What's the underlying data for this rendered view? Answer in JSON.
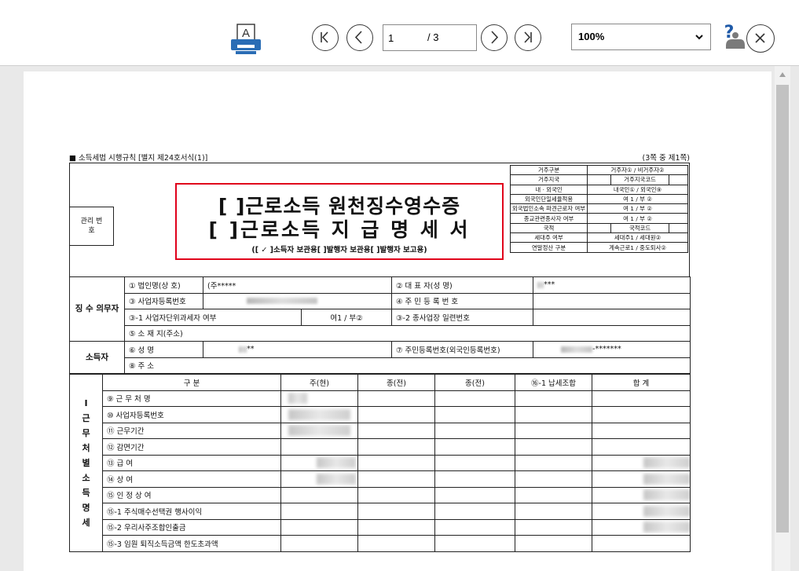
{
  "toolbar": {
    "page_current": "1",
    "page_total": "/ 3",
    "zoom": "100%",
    "icons": {
      "print": "print-icon",
      "first": "first-page-icon",
      "prev": "prev-page-icon",
      "next": "next-page-icon",
      "last": "last-page-icon",
      "help": "help-icon",
      "close": "close-icon"
    }
  },
  "doc": {
    "rule": "■ 소득세법 시행규칙 [별지 제24호서식(1)]",
    "page_info": "(3쪽 중 제1쪽)",
    "mgmt_label": "관리 번호",
    "title1": "[ ]근로소득 원천징수영수증",
    "title2": "[ ]근로소득 지 급 명 세 서",
    "title_options": "([ ✓ ]소득자 보관용[    ]발행자 보관용[    ]발행자 보고용)",
    "resident": [
      [
        "거주구분",
        "거주자① / 비거주자②"
      ],
      [
        "거주지국",
        "",
        "거주지국코드",
        ""
      ],
      [
        "내 · 외국인",
        "내국인① / 외국인⑨"
      ],
      [
        "외국인단일세율적용",
        "여 1 / 부 ②"
      ],
      [
        "외국법인소속 파견근로자 여부",
        "여 1 / 부 ②"
      ],
      [
        "종교관련종사자 여부",
        "여 1 / 부 ②"
      ],
      [
        "국적",
        "",
        "국적코드",
        ""
      ],
      [
        "세대주 여부",
        "세대주1 / 세대원②"
      ],
      [
        "연말정산 구분",
        "계속근로1 / 중도퇴사②"
      ]
    ],
    "payer": {
      "section": "징 수 의무자",
      "company_label": "① 법인명(상 호)",
      "company_value": "(주*****",
      "rep_label": "② 대 표 자(성  명)",
      "rep_value": "***",
      "bizno_label": "③ 사업자등록번호",
      "resno_label": "④ 주 민 등 록 번 호",
      "unit_label": "③-1 사업자단위과세자 여부",
      "unit_value": "여1 / 부②",
      "branch_label": "③-2 종사업장 일련번호",
      "address_label": "⑤ 소 재 지(주소)"
    },
    "earner": {
      "section": "소득자",
      "name_label": "⑥ 성      명",
      "name_value": "**",
      "resno_label": "⑦ 주민등록번호(외국인등록번호)",
      "resno_value": "-*******",
      "address_label": "⑧ 주      소"
    },
    "income": {
      "section": "Ⅰ 근 무 처 별 소 득 명 세",
      "col_label": "구      분",
      "col_main": "주(현)",
      "col_prev1": "종(전)",
      "col_prev2": "종(전)",
      "col_tax": "⑯-1 납세조합",
      "col_total": "합   계",
      "rows": [
        "⑨ 근  무  처  명",
        "⑩ 사업자등록번호",
        "⑪ 근무기간",
        "⑫ 감면기간",
        "⑬ 급          여",
        "⑭ 상          여",
        "⑮ 인  정  상  여",
        "⑮-1 주식매수선택권 행사이익",
        "⑮-2 우리사주조합인출금",
        "⑮-3 임원 퇴직소득금액 한도초과액"
      ]
    }
  }
}
